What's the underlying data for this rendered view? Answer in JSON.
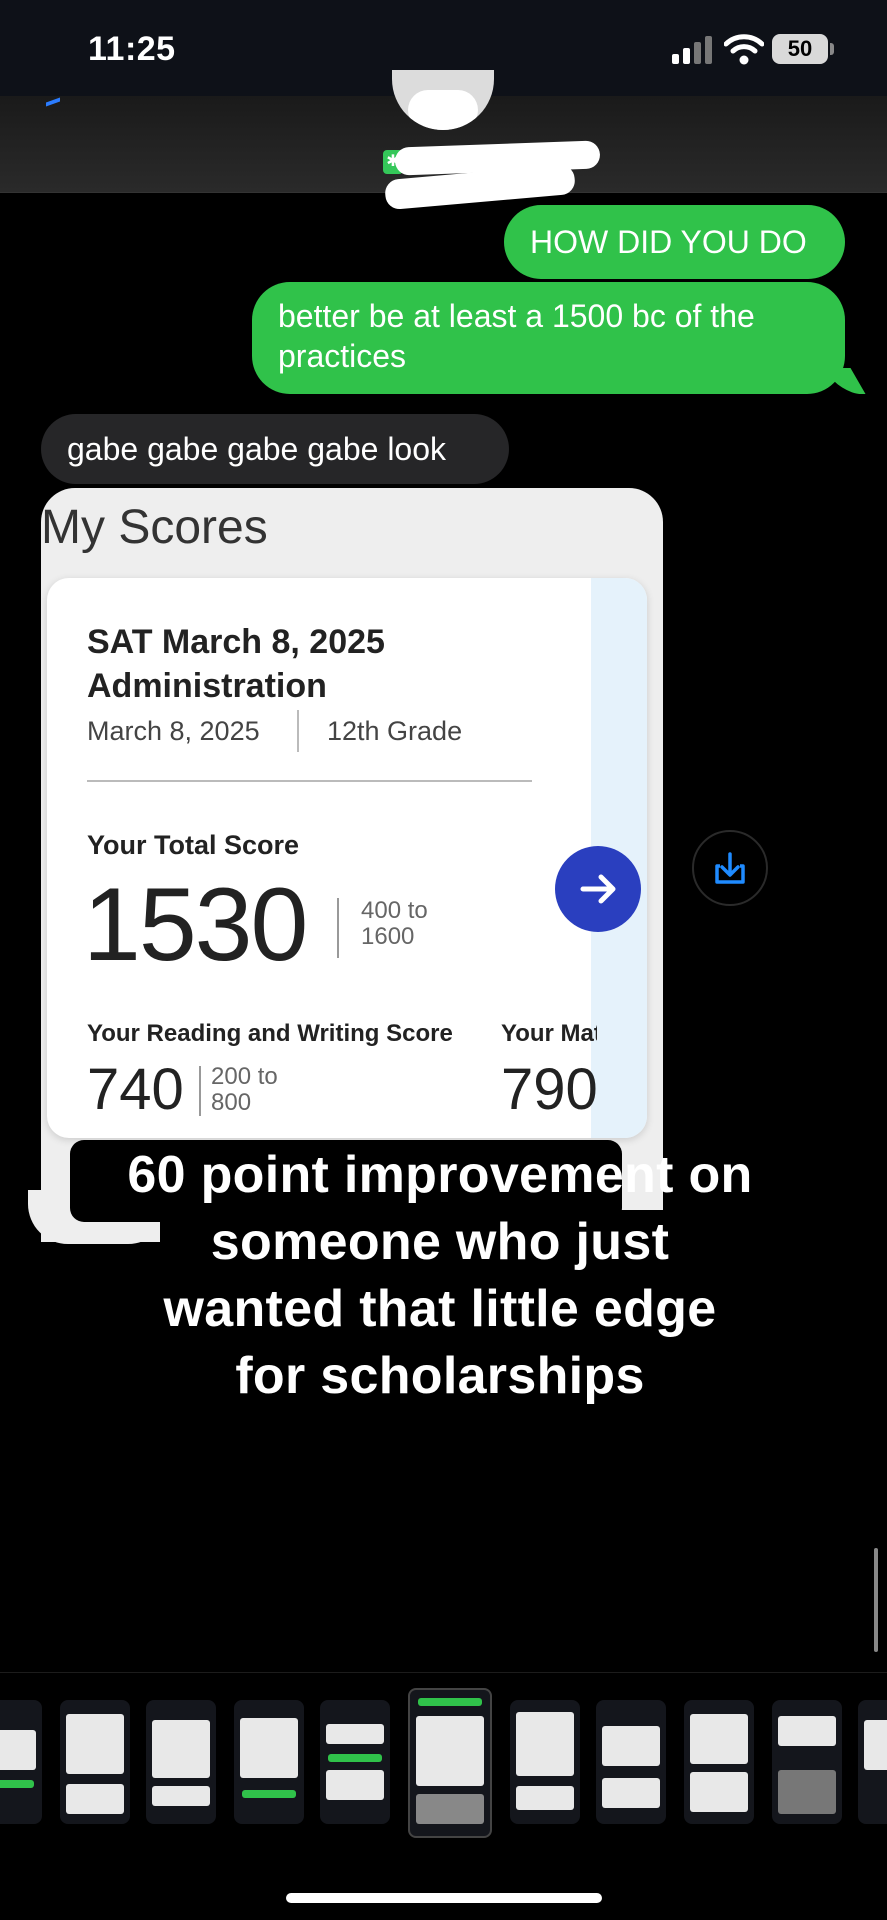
{
  "status_bar": {
    "time": "11:25",
    "battery": "50"
  },
  "conversation": {
    "messages": [
      {
        "from": "me",
        "text": "HOW DID YOU DO"
      },
      {
        "from": "me",
        "text": "better be at least a 1500 bc of the practices"
      },
      {
        "from": "them",
        "text": "gabe gabe gabe gabe look"
      }
    ]
  },
  "score_report": {
    "heading": "My Scores",
    "test_title": "SAT March 8, 2025 Administration",
    "test_date": "March 8, 2025",
    "grade": "12th Grade",
    "total_label": "Your Total Score",
    "total_score": "1530",
    "total_range_low": "400 to",
    "total_range_high": "1600",
    "rw_label": "Your Reading and Writing Score",
    "rw_score": "740",
    "rw_range_low": "200 to",
    "rw_range_high": "800",
    "math_label": "Your Mat",
    "math_score": "790"
  },
  "caption": {
    "lines": [
      "60 point improvement on",
      "someone who just",
      "wanted that little edge",
      "for scholarships"
    ]
  },
  "icons": {
    "arrow": "arrow-right-icon",
    "download": "download-icon"
  },
  "colors": {
    "sent_bubble": "#30c24a",
    "received_bubble": "#262628",
    "arrow_button": "#2a3fbf",
    "download_icon": "#1f8bff"
  }
}
